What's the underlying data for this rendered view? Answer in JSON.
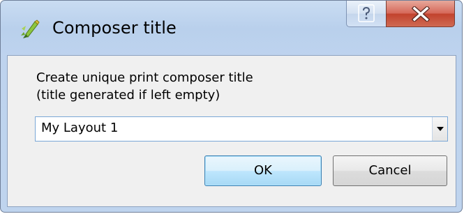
{
  "window": {
    "title": "Composer title",
    "icon": "qgis-composer-icon",
    "help_icon": "question-mark-icon",
    "close_icon": "close-x-icon"
  },
  "dialog": {
    "prompt_line1": "Create unique print composer title",
    "prompt_line2": "(title generated if left empty)",
    "combo": {
      "value": "My Layout 1",
      "arrow_icon": "chevron-down-icon"
    },
    "ok_label": "OK",
    "cancel_label": "Cancel"
  },
  "colors": {
    "title_bar": "#bfd4ee",
    "close_button": "#c2432e",
    "client_bg": "#f0f0f0",
    "focus_border": "#7aa7d6"
  }
}
